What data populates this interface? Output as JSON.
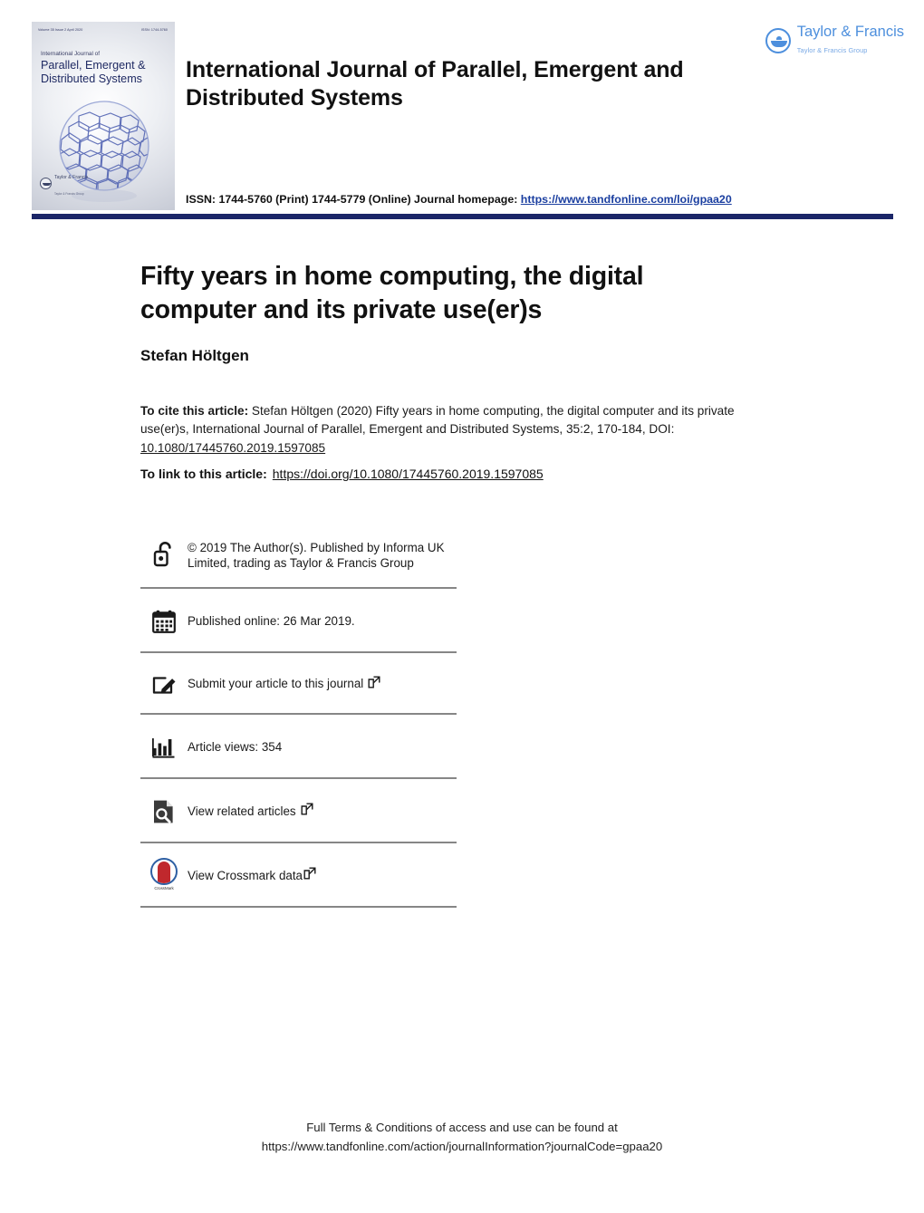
{
  "header": {
    "journal_name": "International Journal of Parallel, Emergent and Distributed Systems",
    "issn_text": "ISSN: 1744-5760 (Print) 1744-5779 (Online) Journal homepage:",
    "issn_link": "https://www.tandfonline.com/loi/gpaa20",
    "publisher_logo": {
      "name": "Taylor & Francis",
      "subtitle": "Taylor & Francis Group",
      "icon": "taylor-francis-lamp-icon",
      "color": "#4d8fdd"
    },
    "rule_color": "#1b2668"
  },
  "cover": {
    "volume_line": "Volume 35 Issue 2 April 2020",
    "issn_line": "ISSN: 1744-5760",
    "pretitle": "International Journal of",
    "title_line1": "Parallel, Emergent &",
    "title_line2": "Distributed Systems",
    "publisher": "Taylor & Francis",
    "publisher_sub": "Taylor & Francis Group",
    "artwork": "buckyball-sphere-graphic"
  },
  "article": {
    "title": "Fifty years in home computing, the digital computer and its private use(er)s",
    "author": "Stefan Höltgen"
  },
  "citation": {
    "label": "To cite this article:",
    "text": " Stefan Höltgen (2020) Fifty years in home computing, the digital computer and its private use(er)s, International Journal of Parallel, Emergent and Distributed Systems, 35:2, 170-184, DOI: ",
    "doi": "10.1080/17445760.2019.1597085"
  },
  "link": {
    "label": "To link to this article:",
    "url": "https://doi.org/10.1080/17445760.2019.1597085"
  },
  "meta_rows": [
    {
      "icon": "open-access-lock-icon",
      "text": "© 2019 The Author(s). Published by Informa UK Limited, trading as Taylor & Francis Group",
      "external": false
    },
    {
      "icon": "calendar-icon",
      "text": "Published online: 26 Mar 2019.",
      "external": false
    },
    {
      "icon": "submit-pencil-icon",
      "text": "Submit your article to this journal",
      "external": true
    },
    {
      "icon": "bar-chart-icon",
      "text": "Article views: 354",
      "external": false
    },
    {
      "icon": "search-document-icon",
      "text": "View related articles",
      "external": true
    },
    {
      "icon": "crossmark-icon",
      "text": "View Crossmark data",
      "external": true,
      "badge_label": "CrossMark"
    }
  ],
  "footer": {
    "line1": "Full Terms & Conditions of access and use can be found at",
    "line2": "https://www.tandfonline.com/action/journalInformation?journalCode=gpaa20"
  }
}
